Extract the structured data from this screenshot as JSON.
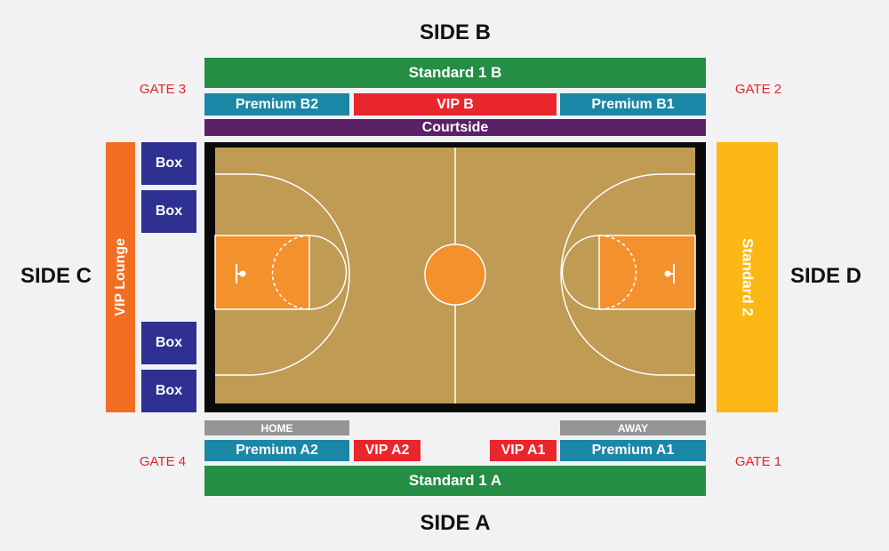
{
  "sides": {
    "a": "SIDE A",
    "b": "SIDE B",
    "c": "SIDE C",
    "d": "SIDE D"
  },
  "gates": {
    "g1": "GATE 1",
    "g2": "GATE 2",
    "g3": "GATE 3",
    "g4": "GATE 4"
  },
  "sections": {
    "standard_1b": "Standard 1 B",
    "premium_b2": "Premium B2",
    "vip_b": "VIP B",
    "premium_b1": "Premium B1",
    "courtside": "Courtside",
    "vip_lounge": "VIP Lounge",
    "standard_2": "Standard 2",
    "box": "Box",
    "home": "HOME",
    "away": "AWAY",
    "premium_a2": "Premium A2",
    "vip_a2": "VIP A2",
    "vip_a1": "VIP A1",
    "premium_a1": "Premium A1",
    "standard_1a": "Standard 1 A"
  },
  "colors": {
    "standard": "#238e44",
    "premium": "#1b87a6",
    "vip": "#e8262c",
    "courtside": "#5b2068",
    "vip_lounge": "#f26f22",
    "standard_2": "#fbb714",
    "box": "#2e3191",
    "bench": "#959595",
    "court_wood": "#bf9b53",
    "court_paint": "#f3912d",
    "court_border": "#0a0a0a",
    "gate_text": "#e2242a"
  }
}
